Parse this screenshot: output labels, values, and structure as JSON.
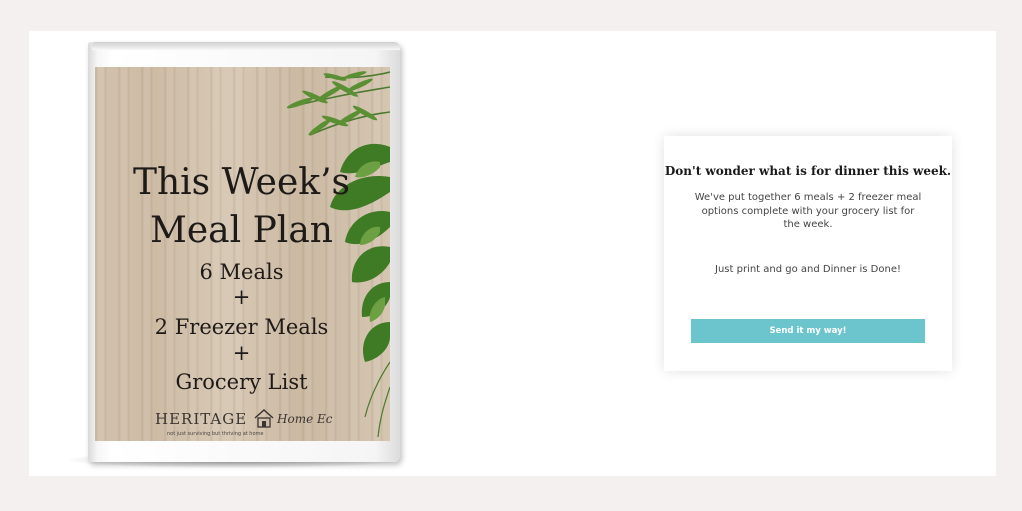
{
  "book": {
    "cover": {
      "title_line1": "This Week’s",
      "title_line2": "Meal Plan",
      "line3": "6 Meals",
      "plus1": "+",
      "line4": "2 Freezer Meals",
      "plus2": "+",
      "line5": "Grocery List"
    },
    "brand": {
      "name": "HERITAGE",
      "script": "Home Ec",
      "tagline": "not just surviving but thriving at home"
    }
  },
  "card": {
    "heading": "Don't wonder what is for dinner this week.",
    "body": "We've put together 6 meals + 2 freezer meal options complete with your grocery list for the week.",
    "tagline": "Just print and go and Dinner is Done!",
    "button_label": "Send it my way!"
  },
  "colors": {
    "page_background": "#f4f0ef",
    "panel_background": "#ffffff",
    "button": "#6cc5cd",
    "heading_text": "#1a1a1a",
    "body_text": "#444444"
  }
}
